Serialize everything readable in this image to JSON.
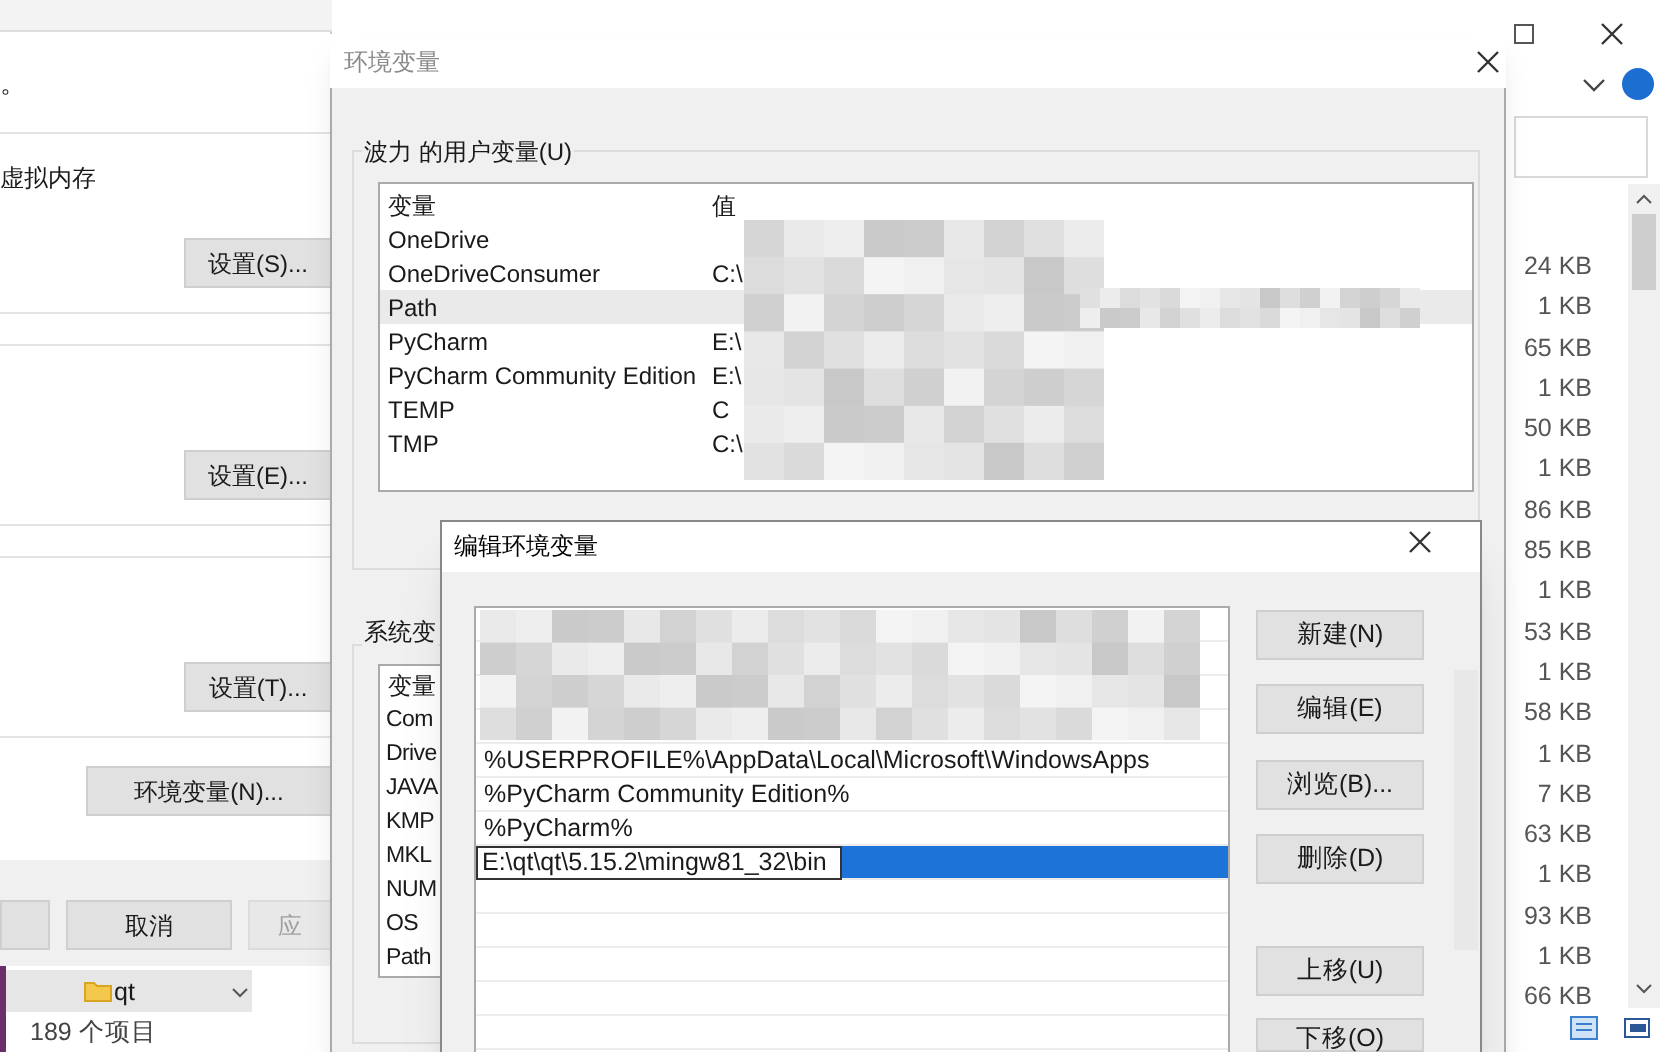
{
  "explorer": {
    "sizes": [
      "24 KB",
      "1 KB",
      "65 KB",
      "1 KB",
      "50 KB",
      "1 KB",
      "86 KB",
      "85 KB",
      "1 KB",
      "53 KB",
      "1 KB",
      "58 KB",
      "1 KB",
      "7 KB",
      "63 KB",
      "1 KB",
      "93 KB",
      "1 KB",
      "66 KB"
    ],
    "folder": "qt",
    "item_count": "189 个项目"
  },
  "system_properties": {
    "texts": [
      "。",
      "虚拟内存"
    ],
    "setting_buttons": [
      "设置(S)...",
      "设置(E)...",
      "设置(T)..."
    ],
    "env_button": "环境变量(N)...",
    "bottom_buttons": [
      {
        "label": "取消",
        "disabled": false
      },
      {
        "label": "应",
        "disabled": true
      }
    ]
  },
  "env_dialog": {
    "title": "环境变量",
    "active": false,
    "user_vars": {
      "group_label": "波力 的用户变量(U)",
      "columns": [
        "变量",
        "值"
      ],
      "rows": [
        {
          "name": "OneDrive",
          "selected": false
        },
        {
          "name": "OneDriveConsumer",
          "value": "C:\\",
          "selected": false
        },
        {
          "name": "Path",
          "selected": true
        },
        {
          "name": "PyCharm",
          "value": "E:\\",
          "selected": false
        },
        {
          "name": "PyCharm Community Edition",
          "value": "E:\\",
          "selected": false
        },
        {
          "name": "TEMP",
          "value": "C",
          "selected": false
        },
        {
          "name": "TMP",
          "value": "C:\\",
          "selected": false
        }
      ]
    },
    "system_vars": {
      "group_label": "系统变",
      "columns": [
        "变量"
      ],
      "rows": [
        "Com",
        "Drive",
        "JAVA",
        "KMP",
        "MKL",
        "NUM",
        "OS",
        "Path"
      ]
    }
  },
  "edit_dialog": {
    "title": "编辑环境变量",
    "entries": [
      {
        "kind": "redacted"
      },
      {
        "kind": "redacted"
      },
      {
        "kind": "redacted"
      },
      {
        "kind": "redacted"
      },
      {
        "kind": "text",
        "text": "%USERPROFILE%\\AppData\\Local\\Microsoft\\WindowsApps"
      },
      {
        "kind": "text",
        "text": "%PyCharm Community Edition%"
      },
      {
        "kind": "text",
        "text": "%PyCharm%"
      },
      {
        "kind": "edit",
        "value": "E:\\qt\\qt\\5.15.2\\mingw81_32\\bin",
        "selected": true
      }
    ],
    "buttons": [
      "新建(N)",
      "编辑(E)",
      "浏览(B)...",
      "删除(D)",
      "上移(U)",
      "下移(O)"
    ]
  }
}
